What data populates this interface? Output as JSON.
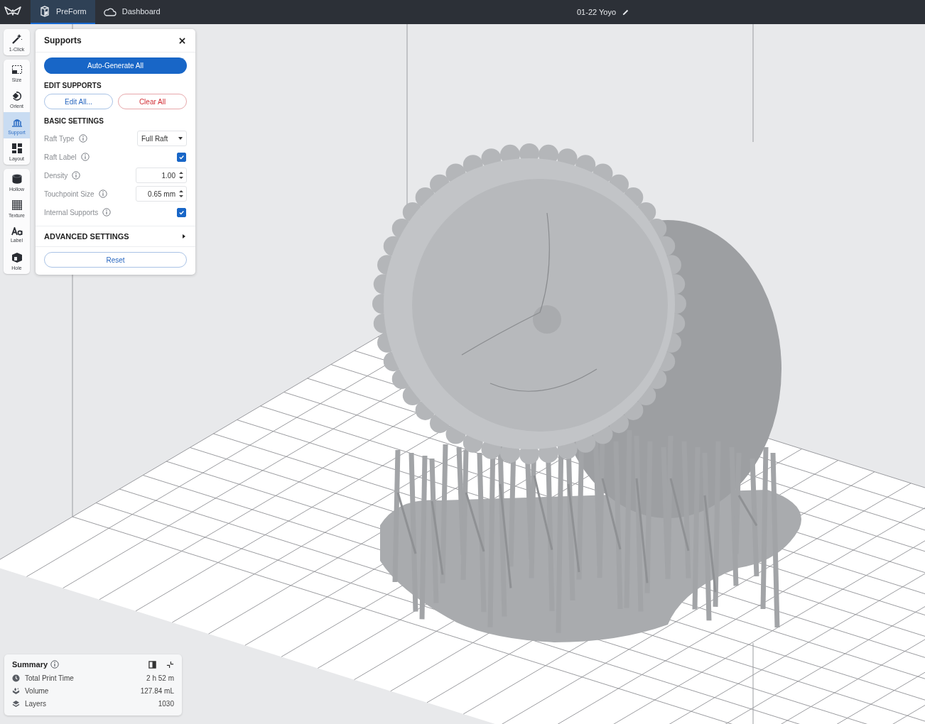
{
  "top_bar": {
    "tabs": [
      {
        "label": "PreForm",
        "kind": "preform",
        "selected": true
      },
      {
        "label": "Dashboard",
        "kind": "dashboard",
        "selected": false
      }
    ],
    "file_title": "01-22 Yoyo"
  },
  "toolbar": {
    "groups": [
      {
        "items": [
          {
            "label": "1-Click",
            "kind": "wand",
            "selected": false
          }
        ]
      },
      {
        "items": [
          {
            "label": "Size",
            "kind": "size",
            "selected": false
          },
          {
            "label": "Orient",
            "kind": "orient",
            "selected": false
          },
          {
            "label": "Support",
            "kind": "support",
            "selected": true
          },
          {
            "label": "Layout",
            "kind": "layout",
            "selected": false
          }
        ]
      },
      {
        "items": [
          {
            "label": "Hollow",
            "kind": "hollow",
            "selected": false
          },
          {
            "label": "Texture",
            "kind": "texture",
            "selected": false
          },
          {
            "label": "Label",
            "kind": "label",
            "selected": false
          },
          {
            "label": "Hole",
            "kind": "hole",
            "selected": false
          }
        ]
      }
    ]
  },
  "supports_panel": {
    "title": "Supports",
    "primary_button": "Auto-Generate All",
    "edit_section": "EDIT SUPPORTS",
    "edit_button": "Edit All...",
    "clear_button": "Clear All",
    "basic_section": "BASIC SETTINGS",
    "settings": [
      {
        "kind": "dropdown",
        "label": "Raft Type",
        "value": "Full Raft"
      },
      {
        "kind": "checkbox",
        "label": "Raft Label",
        "checked": true
      },
      {
        "kind": "spinner",
        "label": "Density",
        "value": "1.00"
      },
      {
        "kind": "spinner",
        "label": "Touchpoint Size",
        "value": "0.65 mm"
      },
      {
        "kind": "checkbox",
        "label": "Internal Supports",
        "checked": true
      }
    ],
    "advanced_section": "ADVANCED SETTINGS",
    "reset_button": "Reset"
  },
  "summary": {
    "title": "Summary",
    "rows": [
      {
        "kind": "time",
        "label": "Total Print Time",
        "value": "2 h 52 m"
      },
      {
        "kind": "volume",
        "label": "Volume",
        "value": "127.84 mL"
      },
      {
        "kind": "layers",
        "label": "Layers",
        "value": "1030"
      }
    ]
  }
}
